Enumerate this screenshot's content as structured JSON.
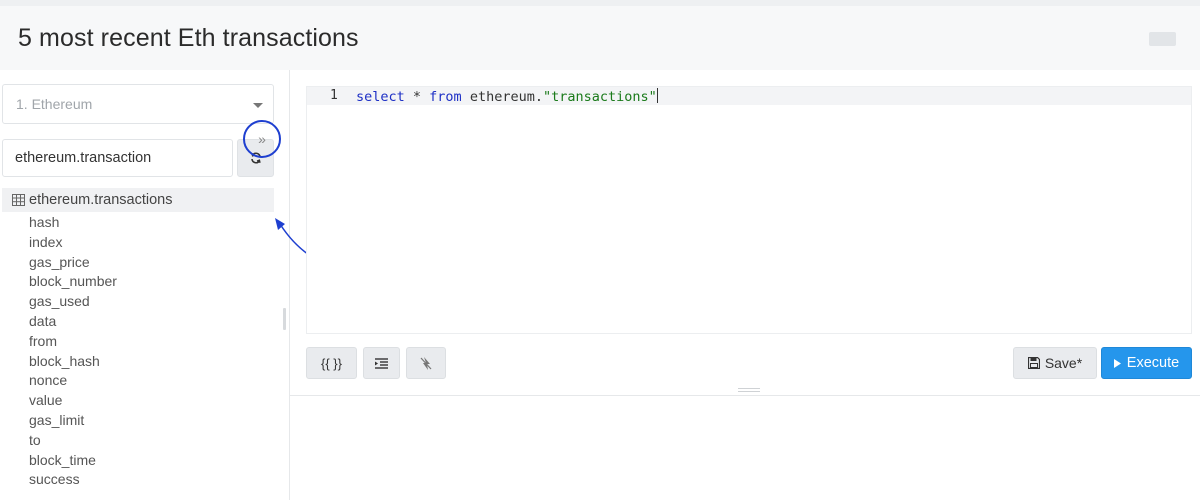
{
  "header": {
    "title": "5 most recent Eth transactions"
  },
  "sidebar": {
    "datasource": "1. Ethereum",
    "search_value": "ethereum.transaction",
    "table": {
      "name": "ethereum.transactions",
      "expand_label": "»",
      "columns": [
        "hash",
        "index",
        "gas_price",
        "block_number",
        "gas_used",
        "data",
        "from",
        "block_hash",
        "nonce",
        "value",
        "gas_limit",
        "to",
        "block_time",
        "success"
      ]
    }
  },
  "editor": {
    "line_number": "1",
    "code": {
      "kw1": "select",
      "star": " * ",
      "kw2": "from",
      "schema": " ethereum.",
      "table": "\"transactions\""
    }
  },
  "toolbar": {
    "params_label": "{{ }}",
    "save_label": "Save*",
    "execute_label": "Execute"
  },
  "colors": {
    "accent": "#2596ec",
    "annotation": "#1e3fd0",
    "keyword": "#1d2fc5",
    "string": "#1a7a1a"
  },
  "icons": [
    "refresh-icon",
    "table-grid-icon",
    "double-chevron-right-icon",
    "indent-icon",
    "autocomplete-icon",
    "floppy-disk-icon",
    "play-icon",
    "caret-down-icon"
  ]
}
